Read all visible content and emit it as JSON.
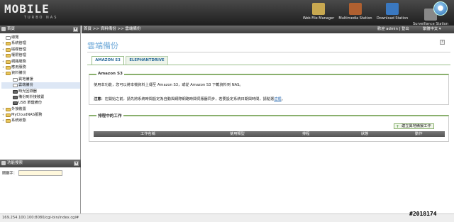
{
  "header": {
    "logo": "MOBILE",
    "logo_sub": "TURBO NAS",
    "apps": [
      {
        "label": "Web File Manager",
        "color": "#c8a850"
      },
      {
        "label": "Multimedia Station",
        "color": "#b06030"
      },
      {
        "label": "Download Station",
        "color": "#3a78c0"
      },
      {
        "label": "Surveillance Station",
        "color": "#888888"
      }
    ]
  },
  "left": {
    "title": "首頁",
    "tree": [
      {
        "label": "總覽",
        "level": 1,
        "exp": "",
        "icon": "doc"
      },
      {
        "label": "系統管理",
        "level": 1,
        "exp": "+",
        "icon": "folder"
      },
      {
        "label": "磁碟管理",
        "level": 1,
        "exp": "+",
        "icon": "folder"
      },
      {
        "label": "權限管理",
        "level": 1,
        "exp": "+",
        "icon": "folder"
      },
      {
        "label": "網路服務",
        "level": 1,
        "exp": "+",
        "icon": "folder"
      },
      {
        "label": "應用服務",
        "level": 1,
        "exp": "+",
        "icon": "folder"
      },
      {
        "label": "資料備份",
        "level": 1,
        "exp": "−",
        "icon": "folder"
      },
      {
        "label": "異地備援",
        "level": 2,
        "exp": "",
        "icon": "doc"
      },
      {
        "label": "雲端備份",
        "level": 2,
        "exp": "",
        "icon": "doc",
        "selected": true
      },
      {
        "label": "時光回溯器",
        "level": 2,
        "exp": "",
        "icon": "dev"
      },
      {
        "label": "備份到外接裝置",
        "level": 2,
        "exp": "",
        "icon": "dev"
      },
      {
        "label": "USB 單鍵備份",
        "level": 2,
        "exp": "",
        "icon": "dev"
      },
      {
        "label": "外接裝置",
        "level": 1,
        "exp": "+",
        "icon": "folder"
      },
      {
        "label": "MyCloudNAS服務",
        "level": 1,
        "exp": "+",
        "icon": "folder"
      },
      {
        "label": "系統狀態",
        "level": 1,
        "exp": "+",
        "icon": "folder"
      }
    ],
    "search_title": "功能搜索",
    "keyword_label": "關鍵字："
  },
  "topbar": {
    "breadcrumb": "首頁 >> 資料備份 >> 雲端備份",
    "user": "歡迎 admin | 登出",
    "lang": "繁體中文 ▾"
  },
  "main": {
    "title": "雲端備份",
    "tabs": [
      "AMAZON S3",
      "ELEPHANTDRIVE"
    ],
    "g1_title": "Amazon S3",
    "g1_text": "使用本功能，您可以將本機資料上傳至 Amazon S3，或從 Amazon S3 下載資料到 NAS。",
    "g1_note_label": "注意：",
    "g1_note": "在開始之前，請先將系統時間設定為自動與網際網路時間伺服器同步，若要設定系統日期與時間，請點選",
    "g1_note_link": "這裡",
    "g2_title": "排程中的工作",
    "new_job": "建立異地備援工作",
    "columns": [
      "工作名稱",
      "使用類型",
      "排程",
      "狀態",
      "動作"
    ]
  },
  "status": {
    "url": "169.254.100.100:8080/cgi-bin/index.cgi#"
  },
  "stamp": "#2018174"
}
